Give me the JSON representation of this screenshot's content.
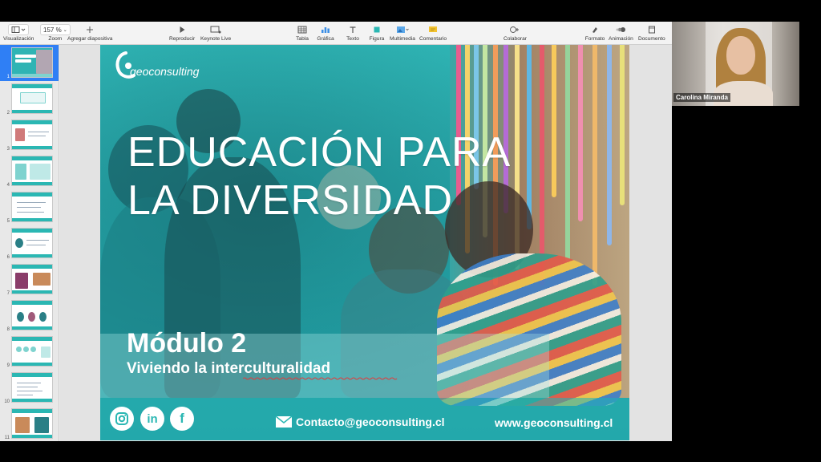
{
  "toolbar": {
    "view_label": "Visualización",
    "zoom_value": "157 %",
    "zoom_label": "Zoom",
    "add_slide_label": "Agregar diapositiva",
    "play_label": "Reproducir",
    "keynote_live_label": "Keynote Live",
    "table_label": "Tabla",
    "chart_label": "Gráfica",
    "text_label": "Texto",
    "shape_label": "Figura",
    "media_label": "Multimedia",
    "comment_label": "Comentario",
    "collaborate_label": "Colaborar",
    "format_label": "Formato",
    "animation_label": "Animación",
    "document_label": "Documento"
  },
  "navigator": {
    "slides": [
      "1",
      "2",
      "3",
      "4",
      "5",
      "6",
      "7",
      "8",
      "9",
      "10",
      "11"
    ],
    "selected": 1
  },
  "slide": {
    "logo_text": "geoconsulting",
    "title_line1": "EDUCACIÓN PARA",
    "title_line2": "LA DIVERSIDAD",
    "module": "Módulo 2",
    "subtitle": "Viviendo la interculturalidad",
    "contact": "Contacto@geoconsulting.cl",
    "website": "www.geoconsulting.cl",
    "social_icons": [
      "instagram-icon",
      "linkedin-icon",
      "facebook-icon"
    ],
    "accent_color": "#2bb7b3"
  },
  "video": {
    "participant_name": "Carolina Miranda"
  }
}
